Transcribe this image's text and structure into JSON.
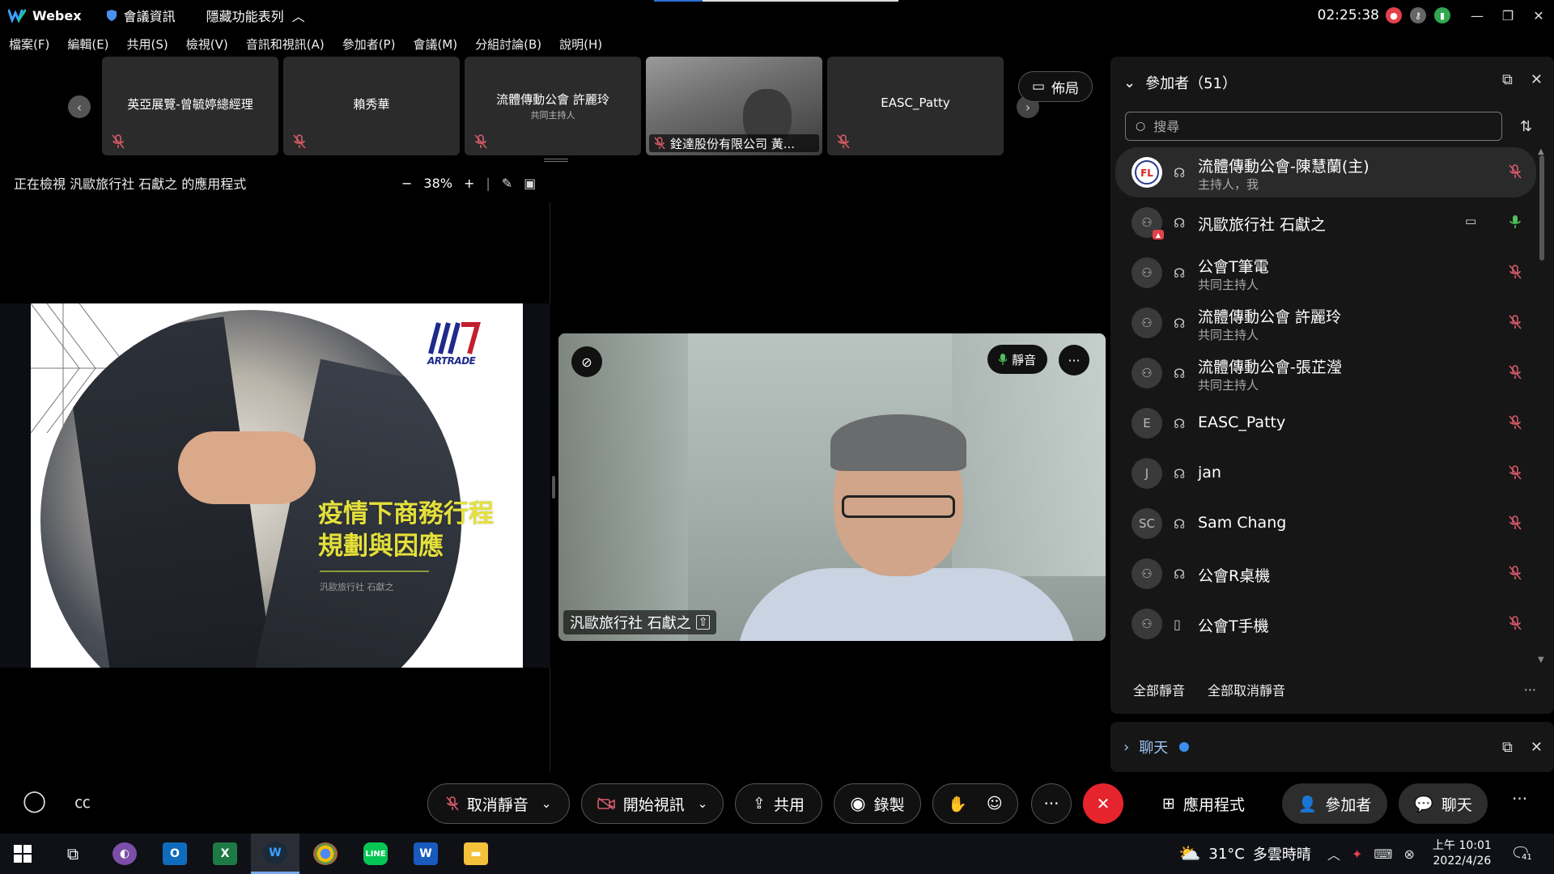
{
  "titlebar": {
    "app_name": "Webex",
    "meeting_info": "會議資訊",
    "hide_menu": "隱藏功能表列",
    "time": "02:25:38"
  },
  "menu": [
    "檔案(F)",
    "編輯(E)",
    "共用(S)",
    "檢視(V)",
    "音訊和視訊(A)",
    "參加者(P)",
    "會議(M)",
    "分組討論(B)",
    "說明(H)"
  ],
  "filmstrip": [
    {
      "name": "英亞展覽-曾毓婷總經理",
      "sub": ""
    },
    {
      "name": "賴秀華",
      "sub": ""
    },
    {
      "name": "流體傳動公會 許麗玲",
      "sub": "共同主持人"
    },
    {
      "name": "銓達股份有限公司 黃...",
      "sub": "",
      "video": true
    },
    {
      "name": "EASC_Patty",
      "sub": ""
    }
  ],
  "layout_button": "佈局",
  "share": {
    "viewing_label": "正在檢視 汎歐旅行社 石獻之 的應用程式",
    "zoom": "38%"
  },
  "slide": {
    "logo_text": "ARTRADE",
    "title_line1": "疫情下商務行程",
    "title_line2": "規劃與因應",
    "author": "汎歐旅行社 石獻之"
  },
  "speaker": {
    "name": "汎歐旅行社 石獻之",
    "mute_label": "靜音"
  },
  "participants": {
    "title": "參加者（51）",
    "search_placeholder": "搜尋",
    "list": [
      {
        "name": "流體傳動公會-陳慧蘭(主)",
        "role": "主持人，我",
        "avatar": "logo",
        "mic": "muted",
        "device": "headset"
      },
      {
        "name": "汎歐旅行社 石獻之",
        "role": "",
        "avatar": "person-sharing",
        "mic": "active",
        "device": "headset",
        "camera": true
      },
      {
        "name": "公會T筆電",
        "role": "共同主持人",
        "avatar": "person",
        "mic": "muted",
        "device": "headset"
      },
      {
        "name": "流體傳動公會 許麗玲",
        "role": "共同主持人",
        "avatar": "person",
        "mic": "muted",
        "device": "headset"
      },
      {
        "name": "流體傳動公會-張芷瀅",
        "role": "共同主持人",
        "avatar": "person",
        "mic": "muted",
        "device": "headset"
      },
      {
        "name": "EASC_Patty",
        "role": "",
        "avatar": "E",
        "mic": "muted",
        "device": "headset"
      },
      {
        "name": "jan",
        "role": "",
        "avatar": "J",
        "mic": "muted",
        "device": "headset"
      },
      {
        "name": "Sam Chang",
        "role": "",
        "avatar": "SC",
        "mic": "muted",
        "device": "headset"
      },
      {
        "name": "公會R桌機",
        "role": "",
        "avatar": "person",
        "mic": "muted",
        "device": "headset"
      },
      {
        "name": "公會T手機",
        "role": "",
        "avatar": "person",
        "mic": "muted",
        "device": "phone"
      }
    ],
    "mute_all": "全部靜音",
    "unmute_all": "全部取消靜音"
  },
  "chat": {
    "title": "聊天"
  },
  "controls": {
    "unmute": "取消靜音",
    "start_video": "開始視訊",
    "share": "共用",
    "record": "錄製",
    "apps": "應用程式",
    "participants": "參加者",
    "chat": "聊天"
  },
  "taskbar": {
    "weather_temp": "31°C",
    "weather_desc": "多雲時晴",
    "clock_time": "上午 10:01",
    "clock_date": "2022/4/26",
    "notifications": "41"
  },
  "colors": {
    "end_call": "#e5242d",
    "slide_title": "#e4e03b",
    "mic_muted": "#d85a6a",
    "mic_active": "#4fc05c",
    "chat_accent": "#3b8ef0"
  }
}
